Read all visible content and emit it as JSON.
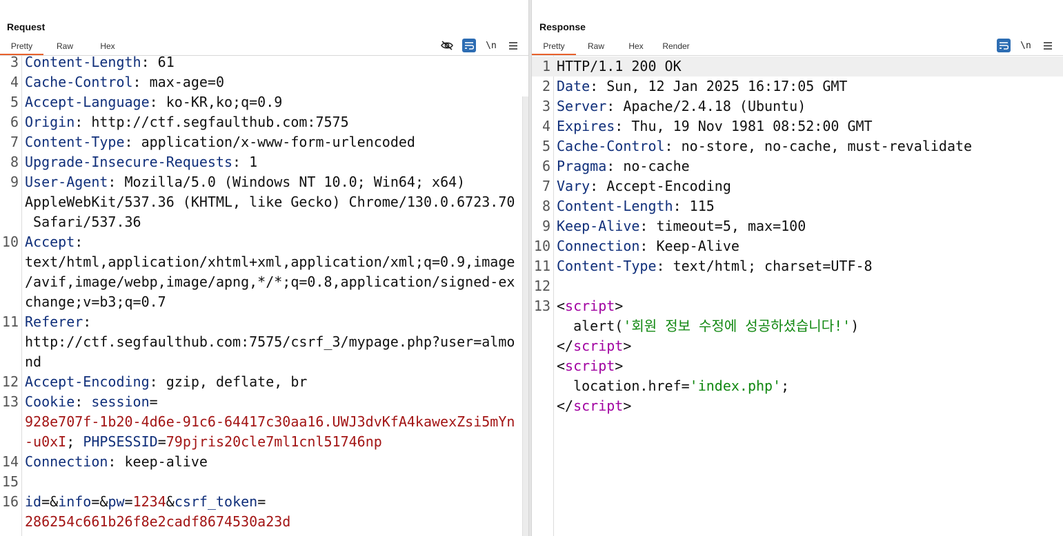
{
  "layout_controls": {
    "icons": [
      "split-vertical-icon",
      "split-horizontal-icon",
      "single-pane-icon"
    ],
    "active": 0
  },
  "request": {
    "title": "Request",
    "tabs": [
      "Pretty",
      "Raw",
      "Hex"
    ],
    "active_tab": 0,
    "toolbar": {
      "hide_icon": "eye-off-icon",
      "wrap_icon": "wrap-lines-icon",
      "newline_label": "\\n",
      "menu_icon": "hamburger-menu-icon"
    },
    "lines": [
      {
        "n": "3",
        "segs": [
          [
            "k",
            "Content-Length"
          ],
          [
            "v",
            ": 61"
          ]
        ]
      },
      {
        "n": "4",
        "segs": [
          [
            "k",
            "Cache-Control"
          ],
          [
            "v",
            ": max-age=0"
          ]
        ]
      },
      {
        "n": "5",
        "segs": [
          [
            "k",
            "Accept-Language"
          ],
          [
            "v",
            ": ko-KR,ko;q=0.9"
          ]
        ]
      },
      {
        "n": "6",
        "segs": [
          [
            "k",
            "Origin"
          ],
          [
            "v",
            ": http://ctf.segfaulthub.com:7575"
          ]
        ]
      },
      {
        "n": "7",
        "segs": [
          [
            "k",
            "Content-Type"
          ],
          [
            "v",
            ": application/x-www-form-urlencoded"
          ]
        ]
      },
      {
        "n": "8",
        "segs": [
          [
            "k",
            "Upgrade-Insecure-Requests"
          ],
          [
            "v",
            ": 1"
          ]
        ]
      },
      {
        "n": "9",
        "segs": [
          [
            "k",
            "User-Agent"
          ],
          [
            "v",
            ": Mozilla/5.0 (Windows NT 10.0; Win64; x64)"
          ]
        ]
      },
      {
        "n": "",
        "segs": [
          [
            "v",
            "AppleWebKit/537.36 (KHTML, like Gecko) Chrome/130.0.6723.70"
          ]
        ]
      },
      {
        "n": "",
        "segs": [
          [
            "v",
            " Safari/537.36"
          ]
        ]
      },
      {
        "n": "10",
        "segs": [
          [
            "k",
            "Accept"
          ],
          [
            "v",
            ":"
          ]
        ]
      },
      {
        "n": "",
        "segs": [
          [
            "v",
            "text/html,application/xhtml+xml,application/xml;q=0.9,image"
          ]
        ]
      },
      {
        "n": "",
        "segs": [
          [
            "v",
            "/avif,image/webp,image/apng,*/*;q=0.8,application/signed-ex"
          ]
        ]
      },
      {
        "n": "",
        "segs": [
          [
            "v",
            "change;v=b3;q=0.7"
          ]
        ]
      },
      {
        "n": "11",
        "segs": [
          [
            "k",
            "Referer"
          ],
          [
            "v",
            ":"
          ]
        ]
      },
      {
        "n": "",
        "segs": [
          [
            "v",
            "http://ctf.segfaulthub.com:7575/csrf_3/mypage.php?user=almo"
          ]
        ]
      },
      {
        "n": "",
        "segs": [
          [
            "v",
            "nd"
          ]
        ]
      },
      {
        "n": "12",
        "segs": [
          [
            "k",
            "Accept-Encoding"
          ],
          [
            "v",
            ": gzip, deflate, br"
          ]
        ]
      },
      {
        "n": "13",
        "segs": [
          [
            "k",
            "Cookie"
          ],
          [
            "v",
            ": "
          ],
          [
            "k",
            "session"
          ],
          [
            "v",
            "="
          ]
        ]
      },
      {
        "n": "",
        "segs": [
          [
            "r",
            "928e707f-1b20-4d6e-91c6-64417c30aa16.UWJ3dvKfA4kawexZsi5mYn"
          ]
        ]
      },
      {
        "n": "",
        "segs": [
          [
            "r",
            "-u0xI"
          ],
          [
            "v",
            "; "
          ],
          [
            "k",
            "PHPSESSID"
          ],
          [
            "v",
            "="
          ],
          [
            "r",
            "79pjris20cle7ml1cnl51746np"
          ]
        ]
      },
      {
        "n": "14",
        "segs": [
          [
            "k",
            "Connection"
          ],
          [
            "v",
            ": keep-alive"
          ]
        ]
      },
      {
        "n": "15",
        "segs": []
      },
      {
        "n": "16",
        "segs": [
          [
            "k",
            "id"
          ],
          [
            "v",
            "=&"
          ],
          [
            "k",
            "info"
          ],
          [
            "v",
            "=&"
          ],
          [
            "k",
            "pw"
          ],
          [
            "v",
            "="
          ],
          [
            "r",
            "1234"
          ],
          [
            "v",
            "&"
          ],
          [
            "k",
            "csrf_token"
          ],
          [
            "v",
            "="
          ]
        ]
      },
      {
        "n": "",
        "segs": [
          [
            "r",
            "286254c661b26f8e2cadf8674530a23d"
          ]
        ]
      }
    ]
  },
  "response": {
    "title": "Response",
    "tabs": [
      "Pretty",
      "Raw",
      "Hex",
      "Render"
    ],
    "active_tab": 0,
    "toolbar": {
      "wrap_icon": "wrap-lines-icon",
      "newline_label": "\\n",
      "menu_icon": "hamburger-menu-icon"
    },
    "lines": [
      {
        "n": "1",
        "hl": true,
        "segs": [
          [
            "v",
            "HTTP/1.1 200 OK"
          ]
        ]
      },
      {
        "n": "2",
        "segs": [
          [
            "k",
            "Date"
          ],
          [
            "v",
            ": Sun, 12 Jan 2025 16:17:05 GMT"
          ]
        ]
      },
      {
        "n": "3",
        "segs": [
          [
            "k",
            "Server"
          ],
          [
            "v",
            ": Apache/2.4.18 (Ubuntu)"
          ]
        ]
      },
      {
        "n": "4",
        "segs": [
          [
            "k",
            "Expires"
          ],
          [
            "v",
            ": Thu, 19 Nov 1981 08:52:00 GMT"
          ]
        ]
      },
      {
        "n": "5",
        "segs": [
          [
            "k",
            "Cache-Control"
          ],
          [
            "v",
            ": no-store, no-cache, must-revalidate"
          ]
        ]
      },
      {
        "n": "6",
        "segs": [
          [
            "k",
            "Pragma"
          ],
          [
            "v",
            ": no-cache"
          ]
        ]
      },
      {
        "n": "7",
        "segs": [
          [
            "k",
            "Vary"
          ],
          [
            "v",
            ": Accept-Encoding"
          ]
        ]
      },
      {
        "n": "8",
        "segs": [
          [
            "k",
            "Content-Length"
          ],
          [
            "v",
            ": 115"
          ]
        ]
      },
      {
        "n": "9",
        "segs": [
          [
            "k",
            "Keep-Alive"
          ],
          [
            "v",
            ": timeout=5, max=100"
          ]
        ]
      },
      {
        "n": "10",
        "segs": [
          [
            "k",
            "Connection"
          ],
          [
            "v",
            ": Keep-Alive"
          ]
        ]
      },
      {
        "n": "11",
        "segs": [
          [
            "k",
            "Content-Type"
          ],
          [
            "v",
            ": text/html; charset=UTF-8"
          ]
        ]
      },
      {
        "n": "12",
        "segs": []
      },
      {
        "n": "13",
        "segs": [
          [
            "v",
            "<"
          ],
          [
            "tag",
            "script"
          ],
          [
            "v",
            ">"
          ]
        ]
      },
      {
        "n": "",
        "segs": [
          [
            "v",
            "  alert("
          ],
          [
            "str",
            "'회원 정보 수정에 성공하셨습니다!'"
          ],
          [
            "v",
            ")"
          ]
        ]
      },
      {
        "n": "",
        "segs": [
          [
            "v",
            "</"
          ],
          [
            "tag",
            "script"
          ],
          [
            "v",
            ">"
          ]
        ]
      },
      {
        "n": "",
        "segs": [
          [
            "v",
            "<"
          ],
          [
            "tag",
            "script"
          ],
          [
            "v",
            ">"
          ]
        ]
      },
      {
        "n": "",
        "segs": [
          [
            "v",
            "  location.href="
          ],
          [
            "str",
            "'index.php'"
          ],
          [
            "v",
            ";"
          ]
        ]
      },
      {
        "n": "",
        "segs": [
          [
            "v",
            "</"
          ],
          [
            "tag",
            "script"
          ],
          [
            "v",
            ">"
          ]
        ]
      }
    ]
  }
}
